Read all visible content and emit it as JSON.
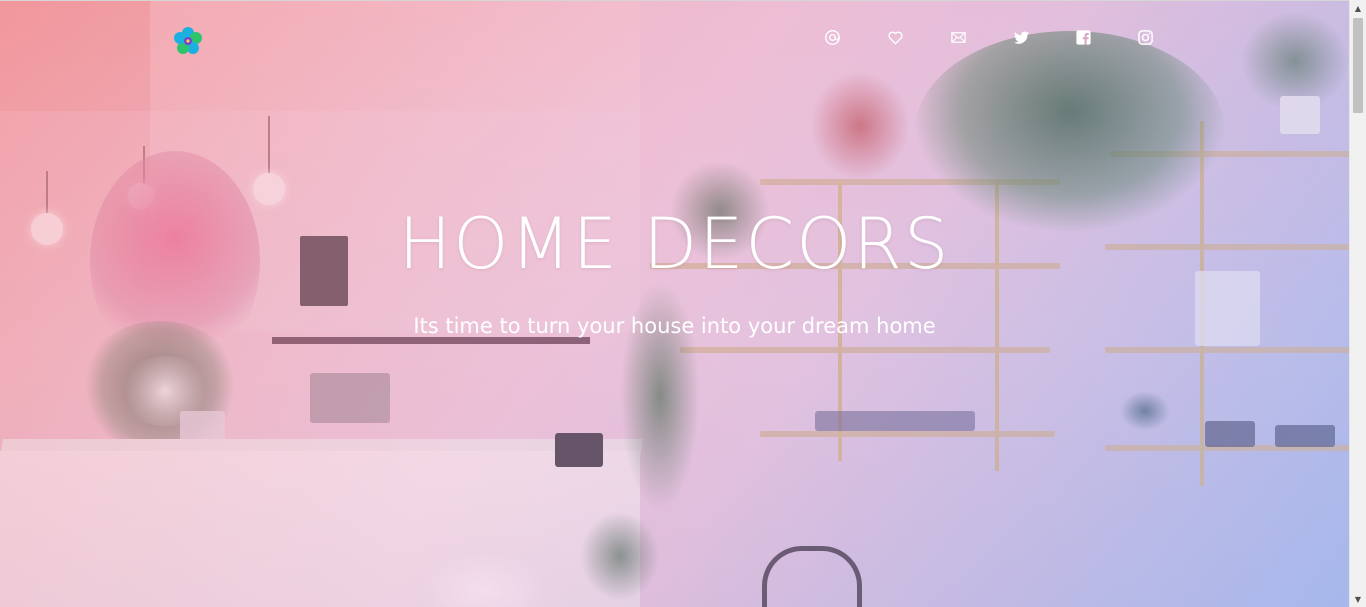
{
  "hero": {
    "title": "HOME DECORS",
    "subtitle": "Its time to turn your house into your dream home"
  },
  "logo": {
    "icon": "flower-logo-icon",
    "colors": [
      "#1bb0e0",
      "#2ec46b",
      "#7b3fd6"
    ]
  },
  "nav": {
    "icons": [
      "account-circle-icon",
      "heart-icon",
      "mail-icon",
      "twitter-icon",
      "facebook-icon",
      "instagram-icon"
    ]
  },
  "colors": {
    "gradient_start": "#f28c8c",
    "gradient_end": "#96afeb",
    "text": "#ffffff"
  }
}
